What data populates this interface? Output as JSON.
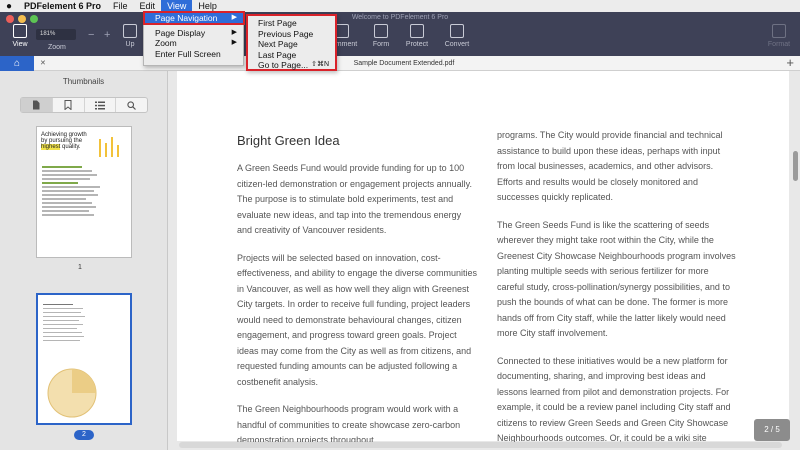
{
  "menubar": {
    "apple": "",
    "app_name": "PDFelement 6 Pro",
    "items": [
      "File",
      "Edit",
      "View",
      "Help"
    ]
  },
  "window": {
    "title": "Welcome to PDFelement 6 Pro"
  },
  "toolbar": {
    "view_label": "View",
    "zoom_value": "181%",
    "zoom_label": "Zoom",
    "zoom_minus": "−",
    "zoom_plus": "+",
    "up_label": "Up",
    "comment_label": "Comment",
    "form_label": "Form",
    "protect_label": "Protect",
    "convert_label": "Convert",
    "format_label": "Format"
  },
  "view_menu": {
    "items": [
      {
        "label": "Page Navigation",
        "has_submenu": true,
        "selected": true
      },
      {
        "label": "Page Display",
        "has_submenu": true
      },
      {
        "label": "Zoom",
        "has_submenu": true
      },
      {
        "label": "Enter Full Screen",
        "has_submenu": false
      }
    ],
    "arrow": "▶"
  },
  "page_nav_submenu": {
    "items": [
      {
        "label": "First Page",
        "shortcut": ""
      },
      {
        "label": "Previous Page",
        "shortcut": ""
      },
      {
        "label": "Next Page",
        "shortcut": ""
      },
      {
        "label": "Last Page",
        "shortcut": ""
      },
      {
        "label": "Go to Page...",
        "shortcut": "⇧⌘N"
      }
    ]
  },
  "tabs": {
    "home_icon": "⌂",
    "document_title": "Sample Document Extended.pdf",
    "close": "✕",
    "add": "+"
  },
  "sidebar": {
    "title": "Thumbnails",
    "tab_icons": [
      "page-icon",
      "bookmark-icon",
      "list-icon",
      "search-icon"
    ],
    "thumbnails": [
      {
        "heading_pre": "Achieving growth by pursuing the ",
        "heading_hl": "highest",
        "heading_post": " quality.",
        "page": "1"
      },
      {
        "page": "2"
      }
    ]
  },
  "document": {
    "heading": "Bright Green Idea",
    "left_paragraphs": [
      "A Green Seeds Fund would provide funding for up to 100 citizen-led demonstration or engagement projects annually. The purpose is to stimulate bold experiments, test and evaluate new ideas, and tap into the tremendous energy and creativity of Vancouver residents.",
      "Projects will be selected based on innovation, cost-effectiveness, and ability to engage the diverse communities in Vancouver, as well as how well they align with Greenest City targets. In order to receive full funding, project leaders would need to demonstrate behavioural changes, citizen engagement, and progress toward green goals. Project ideas may come from the City as well as from citizens, and requested funding amounts can be adjusted following a costbenefit analysis.",
      "The Green Neighbourhoods program would work with a handful of communities to create showcase zero-carbon demonstration projects throughout"
    ],
    "right_paragraphs": [
      "programs. The City would provide financial and technical assistance to build upon these ideas, perhaps with input from local businesses, academics, and other advisors. Efforts and results would be closely monitored and successes quickly replicated.",
      "The Green Seeds Fund is like the scattering of seeds wherever they might take root within the City, while the Greenest City Showcase Neighbourhoods program involves planting multiple seeds with serious fertilizer for more careful study, cross-pollination/synergy possibilities, and to push the bounds of what can be done. The former is more hands off from City staff, while the latter likely would need more City staff involvement.",
      "Connected to these initiatives would be a new platform for documenting, sharing, and improving best ideas and lessons learned from pilot and demonstration projects. For example, it could be a review panel including City staff and citizens to review Green Seeds and Green City Showcase Neighbourhoods outcomes. Or, it could be a wiki site"
    ],
    "page_indicator": "2 / 5"
  },
  "colors": {
    "toolbar_bg": "#3e4157",
    "accent": "#2c64c8",
    "highlight_box": "#d9222a",
    "menu_selected": "#2f6dd8"
  }
}
